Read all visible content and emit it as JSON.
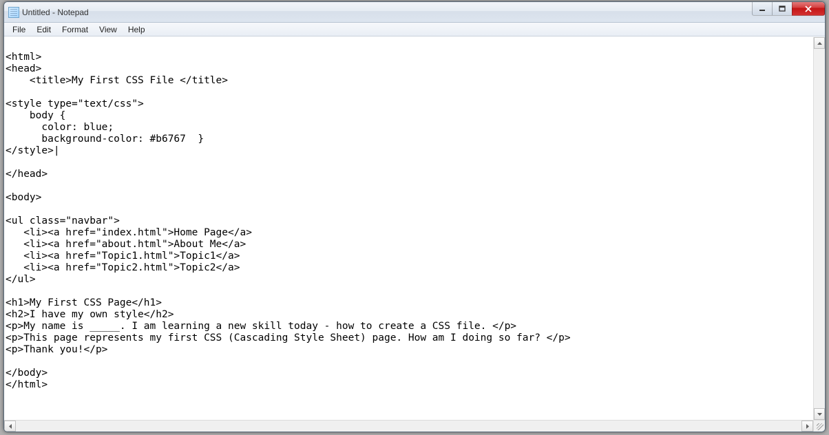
{
  "window": {
    "title": "Untitled - Notepad"
  },
  "menu": {
    "file": "File",
    "edit": "Edit",
    "format": "Format",
    "view": "View",
    "help": "Help"
  },
  "document": {
    "lines": [
      "",
      "<html>",
      "<head>",
      "    <title>My First CSS File </title>",
      "",
      "<style type=\"text/css\">",
      "    body {",
      "      color: blue;",
      "      background-color: #b6767  }",
      "</style>|",
      "",
      "</head>",
      "",
      "<body>",
      "",
      "<ul class=\"navbar\">",
      "   <li><a href=\"index.html\">Home Page</a>",
      "   <li><a href=\"about.html\">About Me</a>",
      "   <li><a href=\"Topic1.html\">Topic1</a>",
      "   <li><a href=\"Topic2.html\">Topic2</a>",
      "</ul>",
      "",
      "<h1>My First CSS Page</h1>",
      "<h2>I have my own style</h2>",
      "<p>My name is _____. I am learning a new skill today - how to create a CSS file. </p>",
      "<p>This page represents my first CSS (Cascading Style Sheet) page. How am I doing so far? </p>",
      "<p>Thank you!</p>",
      "",
      "</body>",
      "</html>"
    ]
  }
}
